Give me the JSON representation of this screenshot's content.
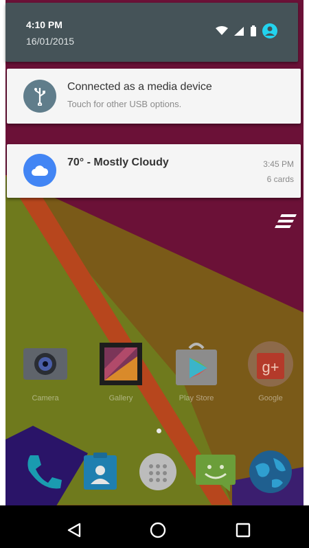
{
  "status_bar": {
    "time": "4:10 PM",
    "date": "16/01/2015",
    "icons": [
      "wifi-icon",
      "signal-icon",
      "battery-icon",
      "user-avatar-icon"
    ]
  },
  "notifications": [
    {
      "icon": "usb-icon",
      "title": "Connected as a media device",
      "subtitle": "Touch for other USB options."
    },
    {
      "icon": "cloud-icon",
      "title": "70° - Mostly Cloudy",
      "time": "3:45 PM",
      "count": "6 cards"
    }
  ],
  "clear_all_icon": "clear-all-icon",
  "home_apps": [
    {
      "label": "Camera",
      "icon": "camera-icon"
    },
    {
      "label": "Gallery",
      "icon": "gallery-icon"
    },
    {
      "label": "Play Store",
      "icon": "play-store-icon"
    },
    {
      "label": "Google",
      "icon": "google-plus-icon"
    }
  ],
  "dock": [
    "phone-icon",
    "contacts-icon",
    "app-drawer-icon",
    "messaging-icon",
    "browser-icon"
  ],
  "nav": [
    "back-icon",
    "home-icon",
    "recents-icon"
  ],
  "colors": {
    "panel": "#455358",
    "accent_cyan": "#22d3ee",
    "weather_blue": "#4285f4",
    "usb_gray": "#607d8b"
  }
}
